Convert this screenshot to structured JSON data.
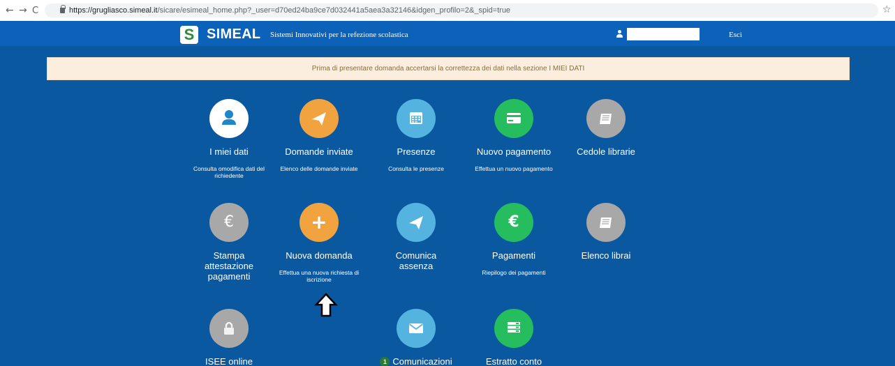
{
  "browser": {
    "back": "←",
    "forward": "→",
    "reload": "C",
    "url_host": "https://grugliasco.simeal.it",
    "url_path": "/sicare/esimeal_home.php?_user=d70ed24ba9ce7d032441a5aea3a32146&idgen_profilo=2&_spid=true",
    "star": "☆"
  },
  "header": {
    "brand": "SIMEAL",
    "tagline": "Sistemi Innovativi per la refezione scolastica",
    "user_value": "",
    "logout": "Esci"
  },
  "notice": "Prima di presentare domanda accertarsi la correttezza dei dati nella sezione I MIEI DATI",
  "tiles": [
    {
      "title": "I miei dati",
      "desc": "Consulta omodifica dati del richiedente",
      "icon": "user-icon",
      "color": "#ffffff"
    },
    {
      "title": "Domande inviate",
      "desc": "Elenco delle domande inviate",
      "icon": "paper-plane-icon",
      "color": "#f1a340"
    },
    {
      "title": "Presenze",
      "desc": "Consulta le presenze",
      "icon": "calendar-icon",
      "color": "#54b4df"
    },
    {
      "title": "Nuovo pagamento",
      "desc": "Effettua un nuovo pagamento",
      "icon": "credit-card-icon",
      "color": "#26bd5e"
    },
    {
      "title": "Cedole librarie",
      "desc": "",
      "icon": "book-icon",
      "color": "#a8a8a8"
    },
    {
      "title": "Stampa attestazione pagamenti",
      "desc": "",
      "icon": "euro-icon",
      "color": "#a8a8a8"
    },
    {
      "title": "Nuova domanda",
      "desc": "Effettua una nuova richiesta di iscrizione",
      "icon": "plus-icon",
      "color": "#f1a340"
    },
    {
      "title": "Comunica assenza",
      "desc": "",
      "icon": "paper-plane-icon",
      "color": "#54b4df"
    },
    {
      "title": "Pagamenti",
      "desc": "Riepilogo dei pagamenti",
      "icon": "euro-icon",
      "color": "#26bd5e"
    },
    {
      "title": "Elenco librai",
      "desc": "",
      "icon": "book-icon",
      "color": "#a8a8a8"
    },
    {
      "title": "ISEE online",
      "desc": "",
      "icon": "lock-icon",
      "color": "#a8a8a8"
    },
    {
      "title": "Comunicazioni",
      "badge": "1",
      "desc": "",
      "icon": "envelope-icon",
      "color": "#54b4df"
    },
    {
      "title": "Estratto conto",
      "desc": "",
      "icon": "list-icon",
      "color": "#26bd5e"
    }
  ],
  "colors": {
    "background": "#0a58a0",
    "appbar": "#0b62b8",
    "notice_bg": "#fbeedf",
    "notice_text": "#8a6d3b"
  }
}
